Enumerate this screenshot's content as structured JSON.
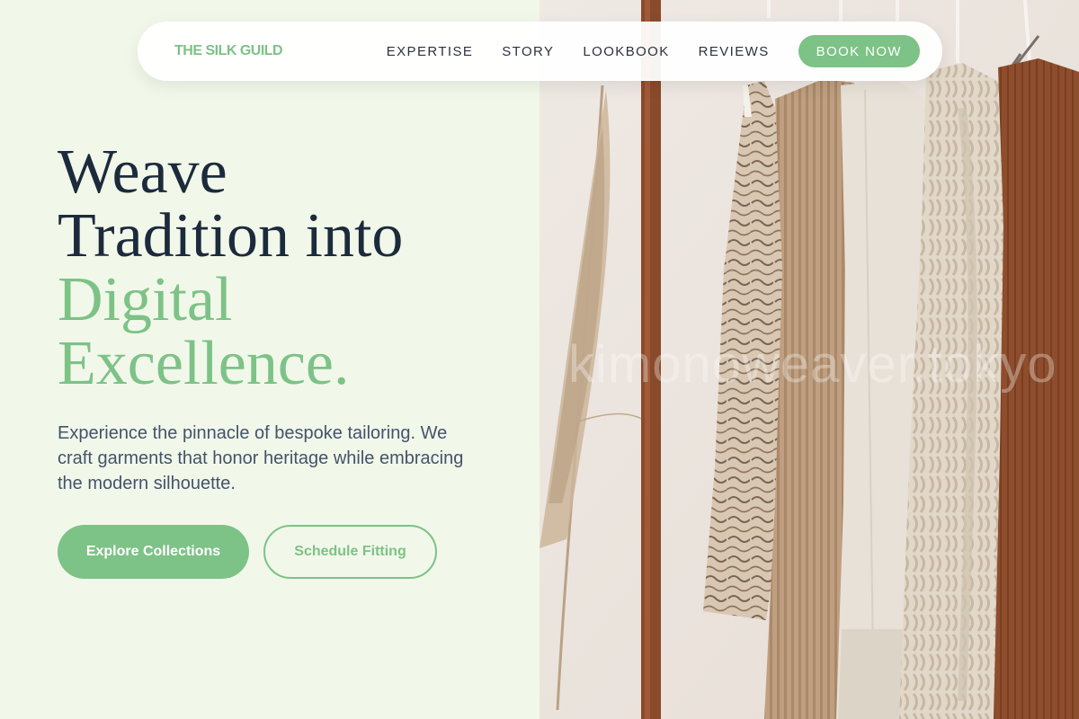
{
  "brand": {
    "name": "THE SILK GUILD"
  },
  "nav": {
    "links": [
      "EXPERTISE",
      "STORY",
      "LOOKBOOK",
      "REVIEWS"
    ],
    "cta_label": "BOOK NOW"
  },
  "hero": {
    "title_dark_line1": "Weave",
    "title_dark_line2": "Tradition into",
    "title_accent_line1": "Digital",
    "title_accent_line2": "Excellence.",
    "description": "Experience the pinnacle of bespoke tailoring. We craft garments that honor heritage while embracing the modern silhouette.",
    "primary_button": "Explore Collections",
    "secondary_button": "Schedule Fitting"
  },
  "photo": {
    "watermark": "kimonoweaver.tokyo"
  },
  "colors": {
    "accent": "#7dc286",
    "heading": "#1c2a3c",
    "body_text": "#44536a",
    "background": "#f1f8ea"
  }
}
